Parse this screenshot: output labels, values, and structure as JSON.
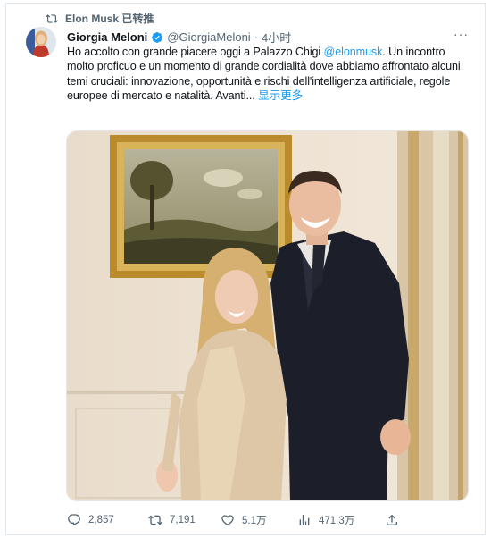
{
  "retweet": {
    "label": "Elon Musk 已转推"
  },
  "tweet": {
    "author_name": "Giorgia Meloni",
    "handle": "@GiorgiaMeloni",
    "separator": "·",
    "time": "4小时",
    "text_before": "Ho accolto con grande piacere oggi a Palazzo Chigi ",
    "mention": "@elonmusk",
    "text_after": ". Un incontro molto proficuo e un momento di grande cordialità dove abbiamo affrontato alcuni temi cruciali: innovazione, opportunità e rischi dell'intelligenza artificiale, regole europee di mercato e natalità. Avanti... ",
    "show_more": "显示更多"
  },
  "actions": {
    "replies": "2,857",
    "retweets": "7,191",
    "likes": "5.1万",
    "views": "471.3万"
  },
  "colors": {
    "link": "#1d9bf0",
    "secondary_text": "#536471",
    "verified": "#1d9bf0"
  },
  "icons": [
    "retweet-icon",
    "verified-badge-icon",
    "more-icon",
    "reply-icon",
    "like-icon",
    "views-icon",
    "share-icon"
  ]
}
